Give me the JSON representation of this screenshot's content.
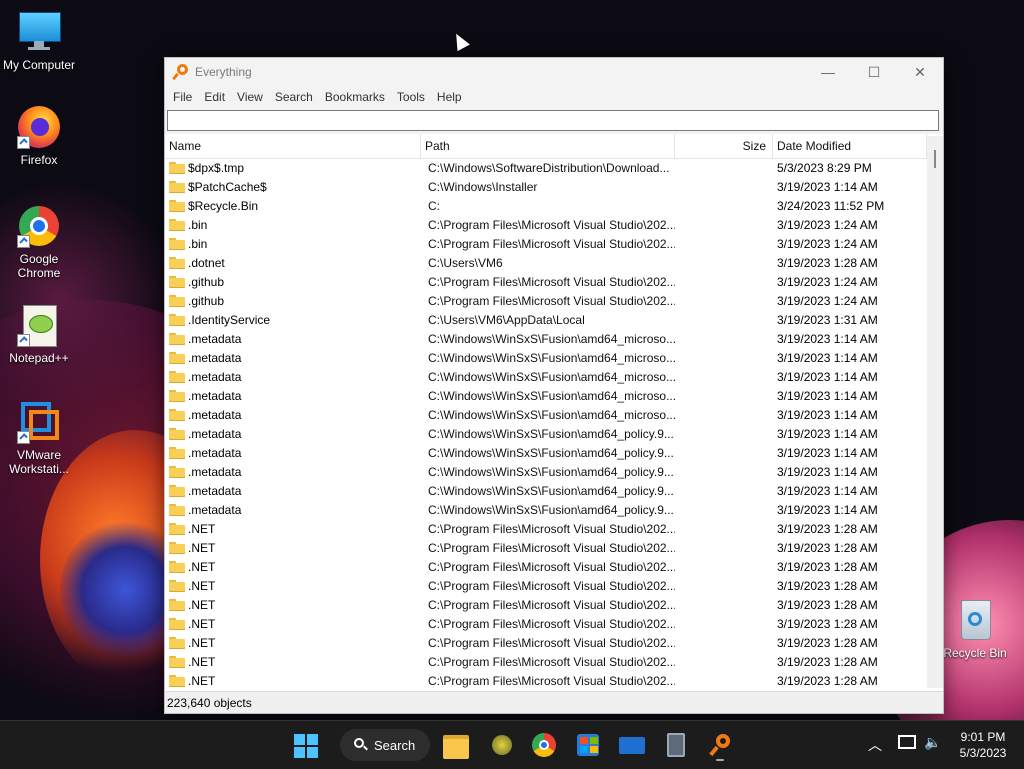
{
  "desktop": {
    "icons": [
      {
        "label": "My Computer",
        "icon": "monitor-icon"
      },
      {
        "label": "Firefox",
        "icon": "firefox-icon"
      },
      {
        "label": "Google Chrome",
        "icon": "chrome-icon"
      },
      {
        "label": "Notepad++",
        "icon": "notepadpp-icon"
      },
      {
        "label": "VMware Workstati...",
        "icon": "vmware-icon"
      },
      {
        "label": "Recycle Bin",
        "icon": "recycle-bin-icon"
      }
    ]
  },
  "window": {
    "title": "Everything",
    "controls": {
      "minimize": "—",
      "maximize": "☐",
      "close": "✕"
    },
    "menu": [
      "File",
      "Edit",
      "View",
      "Search",
      "Bookmarks",
      "Tools",
      "Help"
    ],
    "search": {
      "value": "",
      "placeholder": ""
    },
    "columns": {
      "name": "Name",
      "path": "Path",
      "size": "Size",
      "date": "Date Modified"
    },
    "rows": [
      {
        "name": "$dpx$.tmp",
        "path": "C:\\Windows\\SoftwareDistribution\\Download...",
        "size": "",
        "date": "5/3/2023 8:29 PM"
      },
      {
        "name": "$PatchCache$",
        "path": "C:\\Windows\\Installer",
        "size": "",
        "date": "3/19/2023 1:14 AM"
      },
      {
        "name": "$Recycle.Bin",
        "path": "C:",
        "size": "",
        "date": "3/24/2023 11:52 PM"
      },
      {
        "name": ".bin",
        "path": "C:\\Program Files\\Microsoft Visual Studio\\202...",
        "size": "",
        "date": "3/19/2023 1:24 AM"
      },
      {
        "name": ".bin",
        "path": "C:\\Program Files\\Microsoft Visual Studio\\202...",
        "size": "",
        "date": "3/19/2023 1:24 AM"
      },
      {
        "name": ".dotnet",
        "path": "C:\\Users\\VM6",
        "size": "",
        "date": "3/19/2023 1:28 AM"
      },
      {
        "name": ".github",
        "path": "C:\\Program Files\\Microsoft Visual Studio\\202...",
        "size": "",
        "date": "3/19/2023 1:24 AM"
      },
      {
        "name": ".github",
        "path": "C:\\Program Files\\Microsoft Visual Studio\\202...",
        "size": "",
        "date": "3/19/2023 1:24 AM"
      },
      {
        "name": ".IdentityService",
        "path": "C:\\Users\\VM6\\AppData\\Local",
        "size": "",
        "date": "3/19/2023 1:31 AM"
      },
      {
        "name": ".metadata",
        "path": "C:\\Windows\\WinSxS\\Fusion\\amd64_microso...",
        "size": "",
        "date": "3/19/2023 1:14 AM"
      },
      {
        "name": ".metadata",
        "path": "C:\\Windows\\WinSxS\\Fusion\\amd64_microso...",
        "size": "",
        "date": "3/19/2023 1:14 AM"
      },
      {
        "name": ".metadata",
        "path": "C:\\Windows\\WinSxS\\Fusion\\amd64_microso...",
        "size": "",
        "date": "3/19/2023 1:14 AM"
      },
      {
        "name": ".metadata",
        "path": "C:\\Windows\\WinSxS\\Fusion\\amd64_microso...",
        "size": "",
        "date": "3/19/2023 1:14 AM"
      },
      {
        "name": ".metadata",
        "path": "C:\\Windows\\WinSxS\\Fusion\\amd64_microso...",
        "size": "",
        "date": "3/19/2023 1:14 AM"
      },
      {
        "name": ".metadata",
        "path": "C:\\Windows\\WinSxS\\Fusion\\amd64_policy.9....",
        "size": "",
        "date": "3/19/2023 1:14 AM"
      },
      {
        "name": ".metadata",
        "path": "C:\\Windows\\WinSxS\\Fusion\\amd64_policy.9....",
        "size": "",
        "date": "3/19/2023 1:14 AM"
      },
      {
        "name": ".metadata",
        "path": "C:\\Windows\\WinSxS\\Fusion\\amd64_policy.9....",
        "size": "",
        "date": "3/19/2023 1:14 AM"
      },
      {
        "name": ".metadata",
        "path": "C:\\Windows\\WinSxS\\Fusion\\amd64_policy.9....",
        "size": "",
        "date": "3/19/2023 1:14 AM"
      },
      {
        "name": ".metadata",
        "path": "C:\\Windows\\WinSxS\\Fusion\\amd64_policy.9....",
        "size": "",
        "date": "3/19/2023 1:14 AM"
      },
      {
        "name": ".NET",
        "path": "C:\\Program Files\\Microsoft Visual Studio\\202...",
        "size": "",
        "date": "3/19/2023 1:28 AM"
      },
      {
        "name": ".NET",
        "path": "C:\\Program Files\\Microsoft Visual Studio\\202...",
        "size": "",
        "date": "3/19/2023 1:28 AM"
      },
      {
        "name": ".NET",
        "path": "C:\\Program Files\\Microsoft Visual Studio\\202...",
        "size": "",
        "date": "3/19/2023 1:28 AM"
      },
      {
        "name": ".NET",
        "path": "C:\\Program Files\\Microsoft Visual Studio\\202...",
        "size": "",
        "date": "3/19/2023 1:28 AM"
      },
      {
        "name": ".NET",
        "path": "C:\\Program Files\\Microsoft Visual Studio\\202...",
        "size": "",
        "date": "3/19/2023 1:28 AM"
      },
      {
        "name": ".NET",
        "path": "C:\\Program Files\\Microsoft Visual Studio\\202...",
        "size": "",
        "date": "3/19/2023 1:28 AM"
      },
      {
        "name": ".NET",
        "path": "C:\\Program Files\\Microsoft Visual Studio\\202...",
        "size": "",
        "date": "3/19/2023 1:28 AM"
      },
      {
        "name": ".NET",
        "path": "C:\\Program Files\\Microsoft Visual Studio\\202...",
        "size": "",
        "date": "3/19/2023 1:28 AM"
      },
      {
        "name": ".NET",
        "path": "C:\\Program Files\\Microsoft Visual Studio\\202...",
        "size": "",
        "date": "3/19/2023 1:28 AM"
      }
    ],
    "status": "223,640 objects"
  },
  "taskbar": {
    "search_label": "Search",
    "apps": [
      "start-icon",
      "file-explorer-icon",
      "bug-app-icon",
      "chrome-icon",
      "store-icon",
      "mail-icon",
      "calculator-icon",
      "everything-icon"
    ],
    "time": "9:01 PM",
    "date": "5/3/2023"
  }
}
